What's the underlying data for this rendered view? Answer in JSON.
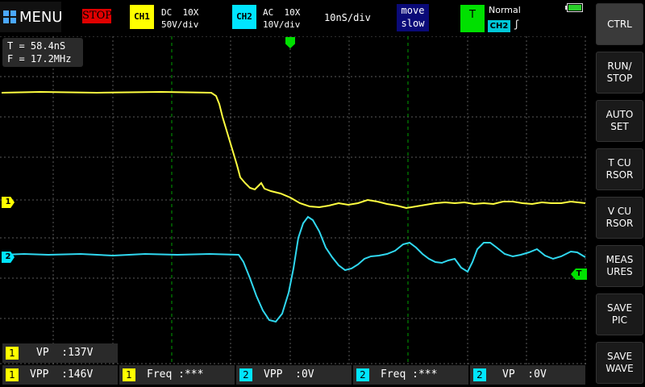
{
  "topbar": {
    "menu_label": "MENU",
    "run_state": "STOP",
    "ch1": {
      "tag": "CH1",
      "coupling": "DC",
      "probe": "10X",
      "scale": "50V/div",
      "color": "#ffff00"
    },
    "ch2": {
      "tag": "CH2",
      "coupling": "AC",
      "probe": "10X",
      "scale": "10V/div",
      "color": "#00e5ff"
    },
    "timebase": "10nS/div",
    "move_line1": "move",
    "move_line2": "slow",
    "trigger": {
      "tag": "T",
      "mode": "Normal",
      "source": "CH2",
      "edge_icon": "falling-edge-icon",
      "color": "#00ff00"
    },
    "battery_icon": "battery-icon"
  },
  "readout": {
    "period": "T = 58.4nS",
    "freq": "F = 17.2MHz"
  },
  "markers": {
    "ch1": "1",
    "ch2": "2",
    "trigger_level": "T"
  },
  "measurements": [
    {
      "ch": "1",
      "text": "VP  :137V",
      "color": "#ffff00"
    },
    {
      "ch": "1",
      "text": "VPP  :146V",
      "color": "#ffff00"
    },
    {
      "ch": "1",
      "text": "Freq :***",
      "color": "#ffff00"
    },
    {
      "ch": "2",
      "text": "VPP  :0V",
      "color": "#00e5ff"
    },
    {
      "ch": "2",
      "text": "Freq :***",
      "color": "#00e5ff"
    },
    {
      "ch": "2",
      "text": "VP  :0V",
      "color": "#00e5ff"
    }
  ],
  "sidebar": [
    {
      "id": "ctrl",
      "line1": "CTRL",
      "line2": ""
    },
    {
      "id": "run-stop",
      "line1": "RUN/",
      "line2": "STOP"
    },
    {
      "id": "auto-set",
      "line1": "AUTO",
      "line2": "SET"
    },
    {
      "id": "t-cursor",
      "line1": "T CU",
      "line2": "RSOR"
    },
    {
      "id": "v-cursor",
      "line1": "V CU",
      "line2": "RSOR"
    },
    {
      "id": "measures",
      "line1": "MEAS",
      "line2": "URES"
    },
    {
      "id": "save-pic",
      "line1": "SAVE",
      "line2": "PIC"
    },
    {
      "id": "save-wave",
      "line1": "SAVE",
      "line2": "WAVE"
    }
  ],
  "colors": {
    "grid": "#5a5a5a",
    "cursor": "#00c000",
    "background": "#000000"
  }
}
